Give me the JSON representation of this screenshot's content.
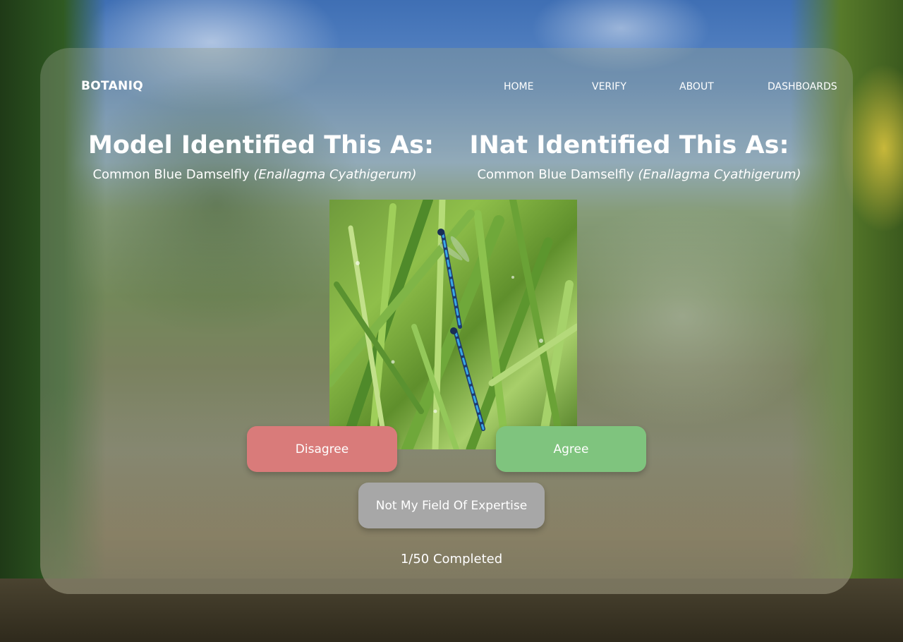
{
  "nav": {
    "logo": "BOTANIQ",
    "links": [
      "HOME",
      "VERIFY",
      "ABOUT",
      "DASHBOARDS"
    ]
  },
  "model": {
    "heading": "Model Identified This As:",
    "common_name": "Common Blue Damselfly",
    "scientific_name": "(Enallagma Cyathigerum)"
  },
  "inat": {
    "heading": "INat Identified This As:",
    "common_name": "Common Blue Damselfly",
    "scientific_name": "(Enallagma Cyathigerum)"
  },
  "buttons": {
    "disagree": "Disagree",
    "agree": "Agree",
    "not_my_field": "Not My Field Of Expertise"
  },
  "progress": {
    "text": "1/50 Completed",
    "completed": 1,
    "total": 50
  },
  "colors": {
    "disagree": "#d97b7a",
    "agree": "#7fc47e",
    "neutral": "#a7a7a7"
  }
}
